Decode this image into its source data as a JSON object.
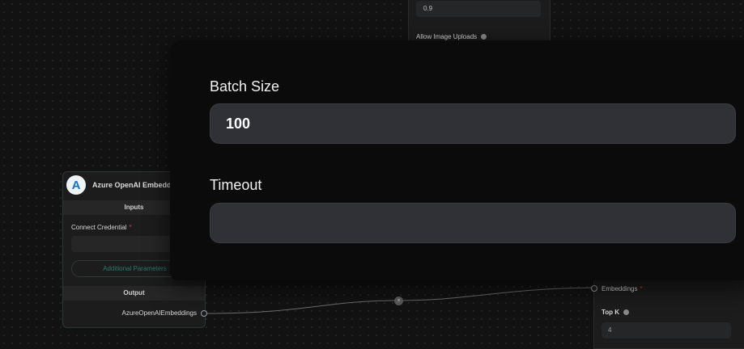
{
  "top_node": {
    "value": "0.9",
    "allow_image_uploads_label": "Allow Image Uploads"
  },
  "azure_node": {
    "title": "Azure OpenAI Embeddi",
    "logo_letter": "A",
    "inputs_label": "Inputs",
    "connect_credential_label": "Connect Credential",
    "required_mark": "*",
    "additional_parameters_label": "Additional Parameters",
    "output_label": "Output",
    "output_item": "AzureOpenAIEmbeddings"
  },
  "edge": {
    "delete_glyph": "×"
  },
  "right_node": {
    "embeddings_label": "Embeddings",
    "required_mark": "*",
    "top_k_label": "Top K",
    "top_k_value": "4"
  },
  "dialog": {
    "batch_size_label": "Batch Size",
    "batch_size_value": "100",
    "timeout_label": "Timeout",
    "timeout_value": ""
  }
}
